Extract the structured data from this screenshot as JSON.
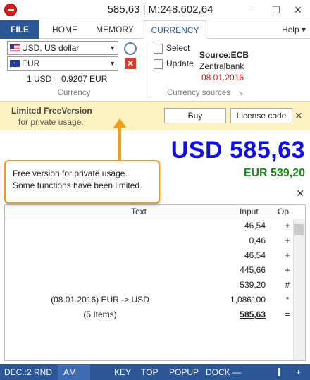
{
  "window": {
    "title": "585,63 | M:248.602,64"
  },
  "tabs": {
    "file": "FILE",
    "home": "HOME",
    "memory": "MEMORY",
    "currency": "CURRENCY",
    "help": "Help ▾"
  },
  "currency_group": {
    "from": "USD, US dollar",
    "to": "EUR",
    "rate": "1 USD = 0.9207 EUR",
    "label": "Currency"
  },
  "sources_group": {
    "select": "Select",
    "update": "Update",
    "source": "Source:ECB",
    "bank": "Zentralbank",
    "date": "08.01.2016",
    "label": "Currency sources"
  },
  "trial": {
    "title": "Limited FreeVersion",
    "subtitle": "for private usage.",
    "buy": "Buy",
    "license": "License code"
  },
  "display": {
    "main": "USD 585,63",
    "secondary": "EUR 539,20"
  },
  "tooltip": {
    "line1": "Free version for private usage.",
    "line2": "Some functions have been limited."
  },
  "tape": {
    "headers": {
      "text": "Text",
      "input": "Input",
      "op": "Op"
    },
    "rows": [
      {
        "text": "",
        "input": "46,54",
        "op": "+"
      },
      {
        "text": "",
        "input": "0,46",
        "op": "+"
      },
      {
        "text": "",
        "input": "46,54",
        "op": "+"
      },
      {
        "text": "",
        "input": "445,66",
        "op": "+"
      },
      {
        "text": "",
        "input": "539,20",
        "op": "#"
      },
      {
        "text": "(08.01.2016) EUR -> USD",
        "input": "1,086100",
        "op": "*"
      },
      {
        "text": "(5 Items)",
        "input": "585,63",
        "op": "="
      }
    ]
  },
  "status": {
    "dec": "DEC.:2",
    "rnd": "RND",
    "am": "AM",
    "key": "KEY",
    "top": "TOP",
    "popup": "POPUP",
    "dock": "DOCK"
  },
  "colors": {
    "accent": "#2b5797",
    "main_value": "#1010e0",
    "secondary_value": "#1a8a1a",
    "tooltip_border": "#f39c12",
    "trial_bg": "#fdf1c2"
  }
}
